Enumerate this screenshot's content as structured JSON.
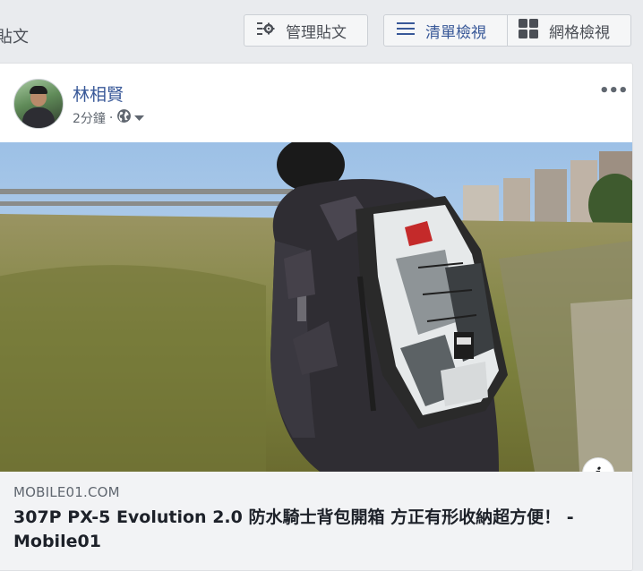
{
  "header": {
    "section_title": "貼文",
    "manage_label": "管理貼文",
    "list_view_label": "清單檢視",
    "grid_view_label": "網格檢視"
  },
  "post": {
    "author": "林相賢",
    "time": "2分鐘",
    "separator": "·",
    "more": "•••",
    "info_icon_text": "i",
    "link": {
      "domain": "MOBILE01.COM",
      "title": "307P PX-5 Evolution 2.0 防水騎士背包開箱 方正有形收納超方便！ - Mobile01"
    }
  },
  "colors": {
    "link_blue": "#385898",
    "background": "#e9ebee",
    "card": "#ffffff",
    "link_box": "#f2f3f5"
  },
  "icons": [
    "manage-icon",
    "list-icon",
    "grid-icon",
    "globe-icon",
    "caret-down-icon",
    "more-icon",
    "info-icon"
  ]
}
